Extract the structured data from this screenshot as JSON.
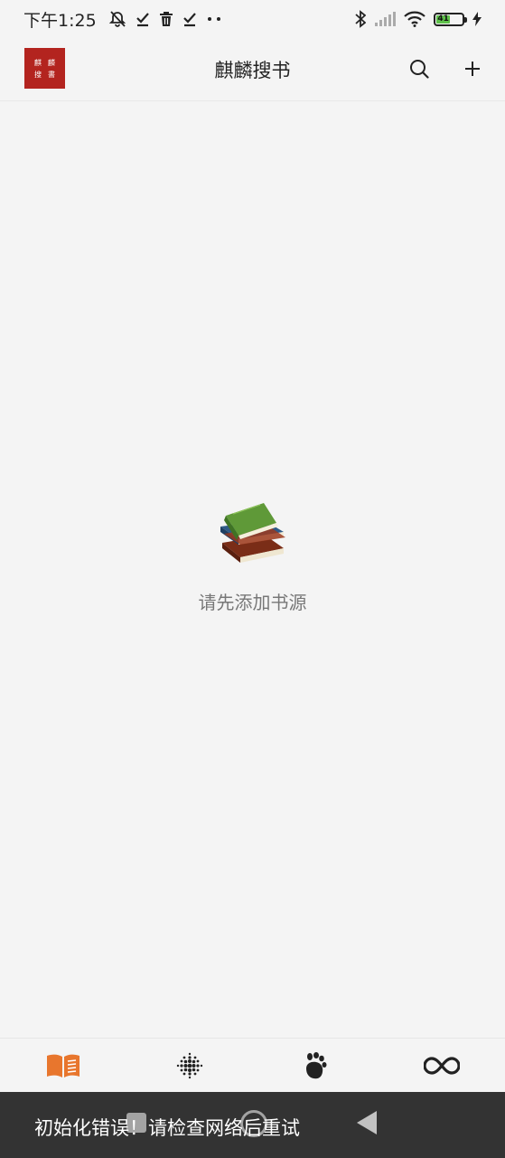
{
  "status_bar": {
    "time": "下午1:25",
    "icons_left": [
      "alarm-off-icon",
      "check-icon",
      "trash-icon",
      "check-icon",
      "more-dots-icon"
    ],
    "icons_right": [
      "bluetooth-icon",
      "signal-icon",
      "wifi-icon",
      "battery-icon",
      "charging-icon"
    ],
    "battery_level": "41",
    "battery_color": "#5ec04a"
  },
  "app_bar": {
    "logo_chars": [
      "麒",
      "麟",
      "搜",
      "書"
    ],
    "logo_color": "#b3241f",
    "title": "麒麟搜书"
  },
  "empty_state": {
    "message": "请先添加书源"
  },
  "bottom_nav": {
    "items": [
      {
        "icon": "open-book-icon",
        "active": true
      },
      {
        "icon": "dot-grid-icon",
        "active": false
      },
      {
        "icon": "paw-icon",
        "active": false
      },
      {
        "icon": "infinity-icon",
        "active": false
      }
    ],
    "active_color": "#e8762d"
  },
  "toast": {
    "message": "初始化错误！请检查网络后重试"
  }
}
